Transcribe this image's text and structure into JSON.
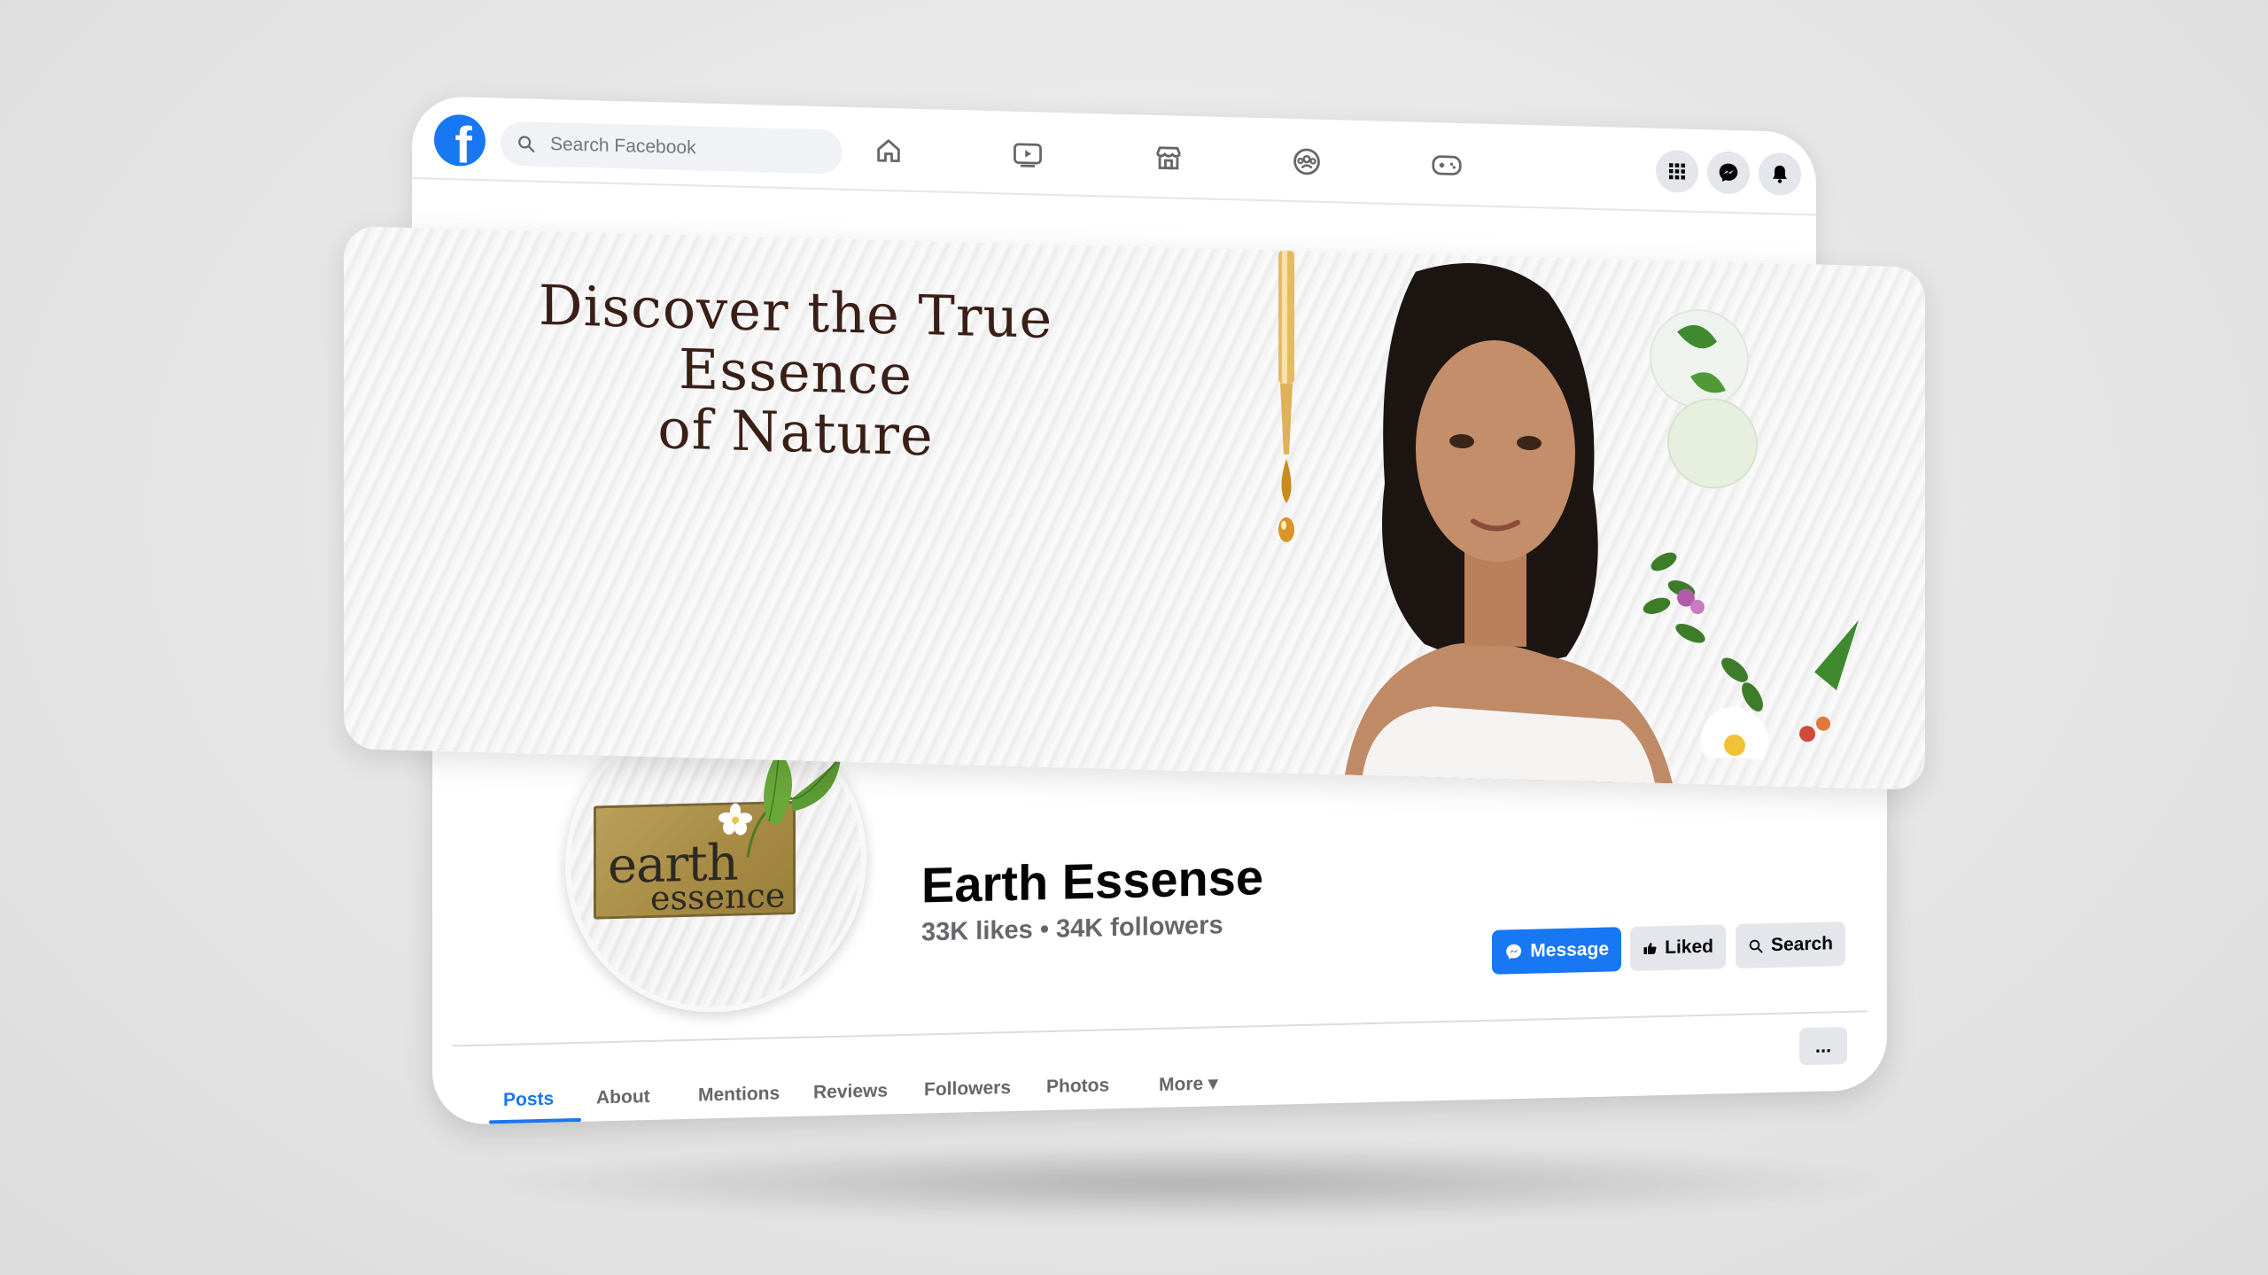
{
  "header": {
    "logo_letter": "f",
    "search_placeholder": "Search Facebook",
    "nav_icons": [
      "home-icon",
      "watch-icon",
      "marketplace-icon",
      "groups-icon",
      "gaming-icon"
    ],
    "right_icons": [
      "menu-grid-icon",
      "messenger-icon",
      "notifications-bell-icon"
    ]
  },
  "cover": {
    "headline_line1": "Discover the True Essence",
    "headline_line2": "of Nature"
  },
  "profile": {
    "logo_word1": "earth",
    "logo_word2": "essence",
    "page_name": "Earth Essense",
    "stats": "33K likes • 34K followers"
  },
  "actions": {
    "message_label": "Message",
    "liked_label": "Liked",
    "search_label": "Search",
    "more_label": "..."
  },
  "tabs": [
    {
      "label": "Posts",
      "active": true
    },
    {
      "label": "About"
    },
    {
      "label": "Mentions"
    },
    {
      "label": "Reviews"
    },
    {
      "label": "Followers"
    },
    {
      "label": "Photos"
    },
    {
      "label": "More ▾"
    }
  ],
  "colors": {
    "facebook_blue": "#1877f2",
    "text_primary": "#050505",
    "text_secondary": "#65676b",
    "headline_brown": "#3a1f16",
    "logo_gold": "#b9a05a"
  }
}
